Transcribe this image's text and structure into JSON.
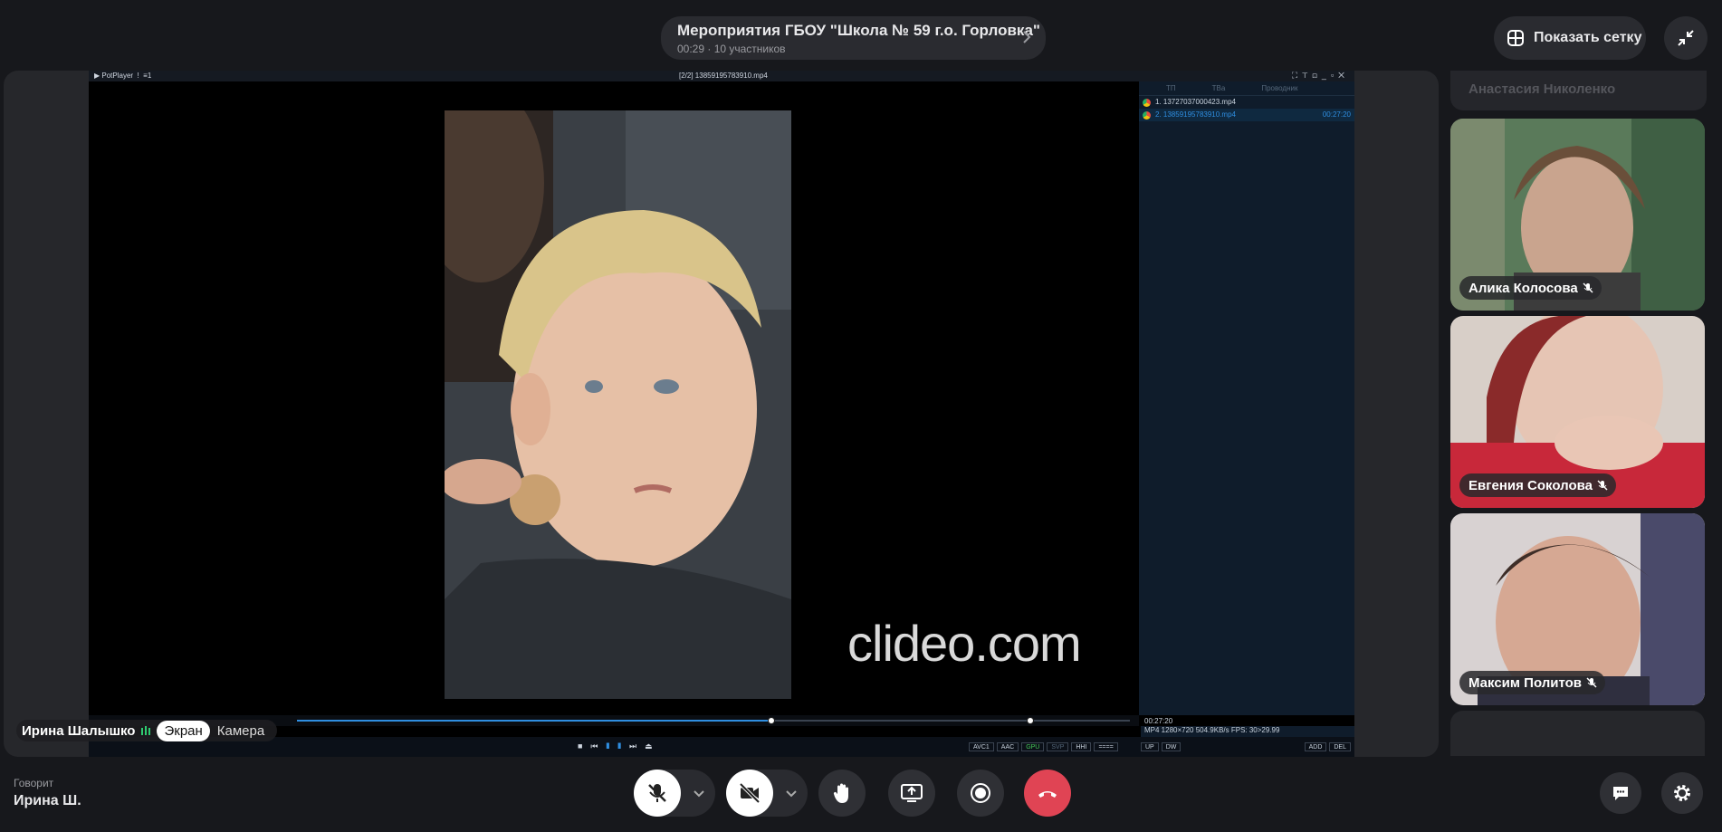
{
  "header": {
    "meeting_title": "Мероприятия ГБОУ \"Школа № 59 г.о. Горловка\"",
    "meeting_subtitle": "00:29 · 10 участников",
    "grid_button_label": "Показать сетку"
  },
  "player": {
    "brand": "PotPlayer",
    "filename": "[2/2] 13859195783910.mp4",
    "watermark": "clideo.com",
    "playlist_tabs": [
      "ТП",
      "ТВа",
      "Проводник"
    ],
    "playlist": [
      {
        "name": "1. 13727037000423.mp4",
        "duration": ""
      },
      {
        "name": "2. 13859195783910.mp4",
        "duration": "00:27:20"
      }
    ],
    "time": "00:27:20",
    "info": "MP4  1280×720  504.9KB/s  FPS: 30>29.99",
    "progress": 0.57,
    "volume": 0.88,
    "badges": [
      "AVC1",
      "AAC",
      "GPU",
      "SVP",
      "HHI",
      "===="
    ],
    "badges_right": [
      "UP",
      "DW"
    ],
    "badges_right2": [
      "ADD",
      "DEL"
    ]
  },
  "presenter": {
    "name": "Ирина Шалышко",
    "screen_label": "Экран",
    "camera_label": "Камера"
  },
  "participants": {
    "top_name": "Анастасия Николенко",
    "tiles": [
      {
        "name": "Алика Колосова"
      },
      {
        "name": "Евгения Соколова"
      },
      {
        "name": "Максим Политов"
      }
    ]
  },
  "footer": {
    "speaking_label": "Говорит",
    "speaking_name": "Ирина Ш."
  },
  "colors": {
    "accent": "#2f8ee0",
    "end_call": "#e04454",
    "background": "#17181c"
  }
}
